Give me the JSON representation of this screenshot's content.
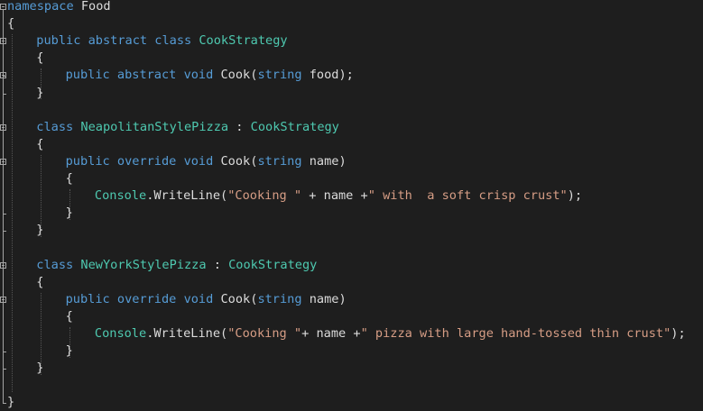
{
  "editor": {
    "theme_colors": {
      "background": "#1e1e1e",
      "keyword": "#569cd6",
      "type": "#4ec9b0",
      "string": "#d69d85",
      "method": "#dcdcaa",
      "plain": "#dcdcdc"
    },
    "lines": [
      {
        "indent": 0,
        "tokens": [
          {
            "t": "namespace",
            "c": "kw"
          },
          {
            "t": " Food",
            "c": "pl"
          }
        ]
      },
      {
        "indent": 0,
        "tokens": [
          {
            "t": "{",
            "c": "pl"
          }
        ]
      },
      {
        "indent": 1,
        "tokens": [
          {
            "t": "public",
            "c": "kw"
          },
          {
            "t": " ",
            "c": "pl"
          },
          {
            "t": "abstract",
            "c": "kw"
          },
          {
            "t": " ",
            "c": "pl"
          },
          {
            "t": "class",
            "c": "kw"
          },
          {
            "t": " ",
            "c": "pl"
          },
          {
            "t": "CookStrategy",
            "c": "ty"
          }
        ]
      },
      {
        "indent": 1,
        "tokens": [
          {
            "t": "{",
            "c": "pl"
          }
        ]
      },
      {
        "indent": 2,
        "tokens": [
          {
            "t": "public",
            "c": "kw"
          },
          {
            "t": " ",
            "c": "pl"
          },
          {
            "t": "abstract",
            "c": "kw"
          },
          {
            "t": " ",
            "c": "pl"
          },
          {
            "t": "void",
            "c": "kw"
          },
          {
            "t": " ",
            "c": "pl"
          },
          {
            "t": "Cook",
            "c": "pl"
          },
          {
            "t": "(",
            "c": "pl"
          },
          {
            "t": "string",
            "c": "kw"
          },
          {
            "t": " food);",
            "c": "pl"
          }
        ]
      },
      {
        "indent": 1,
        "tokens": [
          {
            "t": "}",
            "c": "pl"
          }
        ]
      },
      {
        "indent": 0,
        "tokens": []
      },
      {
        "indent": 1,
        "tokens": [
          {
            "t": "class",
            "c": "kw"
          },
          {
            "t": " ",
            "c": "pl"
          },
          {
            "t": "NeapolitanStylePizza",
            "c": "ty"
          },
          {
            "t": " : ",
            "c": "pl"
          },
          {
            "t": "CookStrategy",
            "c": "ty"
          }
        ]
      },
      {
        "indent": 1,
        "tokens": [
          {
            "t": "{",
            "c": "pl"
          }
        ]
      },
      {
        "indent": 2,
        "tokens": [
          {
            "t": "public",
            "c": "kw"
          },
          {
            "t": " ",
            "c": "pl"
          },
          {
            "t": "override",
            "c": "kw"
          },
          {
            "t": " ",
            "c": "pl"
          },
          {
            "t": "void",
            "c": "kw"
          },
          {
            "t": " ",
            "c": "pl"
          },
          {
            "t": "Cook",
            "c": "pl"
          },
          {
            "t": "(",
            "c": "pl"
          },
          {
            "t": "string",
            "c": "kw"
          },
          {
            "t": " name)",
            "c": "pl"
          }
        ]
      },
      {
        "indent": 2,
        "tokens": [
          {
            "t": "{",
            "c": "pl"
          }
        ]
      },
      {
        "indent": 3,
        "tokens": [
          {
            "t": "Console",
            "c": "ty"
          },
          {
            "t": ".",
            "c": "pl"
          },
          {
            "t": "WriteLine",
            "c": "pl"
          },
          {
            "t": "(",
            "c": "pl"
          },
          {
            "t": "\"Cooking \"",
            "c": "str"
          },
          {
            "t": " + name +",
            "c": "pl"
          },
          {
            "t": "\" with  a soft crisp crust\"",
            "c": "str"
          },
          {
            "t": ");",
            "c": "pl"
          }
        ]
      },
      {
        "indent": 2,
        "tokens": [
          {
            "t": "}",
            "c": "pl"
          }
        ]
      },
      {
        "indent": 1,
        "tokens": [
          {
            "t": "}",
            "c": "pl"
          }
        ]
      },
      {
        "indent": 0,
        "tokens": []
      },
      {
        "indent": 1,
        "tokens": [
          {
            "t": "class",
            "c": "kw"
          },
          {
            "t": " ",
            "c": "pl"
          },
          {
            "t": "NewYorkStylePizza",
            "c": "ty"
          },
          {
            "t": " : ",
            "c": "pl"
          },
          {
            "t": "CookStrategy",
            "c": "ty"
          }
        ]
      },
      {
        "indent": 1,
        "tokens": [
          {
            "t": "{",
            "c": "pl"
          }
        ]
      },
      {
        "indent": 2,
        "tokens": [
          {
            "t": "public",
            "c": "kw"
          },
          {
            "t": " ",
            "c": "pl"
          },
          {
            "t": "override",
            "c": "kw"
          },
          {
            "t": " ",
            "c": "pl"
          },
          {
            "t": "void",
            "c": "kw"
          },
          {
            "t": " ",
            "c": "pl"
          },
          {
            "t": "Cook",
            "c": "pl"
          },
          {
            "t": "(",
            "c": "pl"
          },
          {
            "t": "string",
            "c": "kw"
          },
          {
            "t": " name)",
            "c": "pl"
          }
        ]
      },
      {
        "indent": 2,
        "tokens": [
          {
            "t": "{",
            "c": "pl"
          }
        ]
      },
      {
        "indent": 3,
        "tokens": [
          {
            "t": "Console",
            "c": "ty"
          },
          {
            "t": ".",
            "c": "pl"
          },
          {
            "t": "WriteLine",
            "c": "pl"
          },
          {
            "t": "(",
            "c": "pl"
          },
          {
            "t": "\"Cooking \"",
            "c": "str"
          },
          {
            "t": "+ name +",
            "c": "pl"
          },
          {
            "t": "\" pizza with large hand-tossed thin crust\"",
            "c": "str"
          },
          {
            "t": ");",
            "c": "pl"
          }
        ]
      },
      {
        "indent": 2,
        "tokens": [
          {
            "t": "}",
            "c": "pl"
          }
        ]
      },
      {
        "indent": 1,
        "tokens": [
          {
            "t": "}",
            "c": "pl"
          }
        ]
      },
      {
        "indent": 0,
        "tokens": []
      },
      {
        "indent": 0,
        "tokens": [
          {
            "t": "}",
            "c": "pl"
          }
        ]
      }
    ]
  }
}
